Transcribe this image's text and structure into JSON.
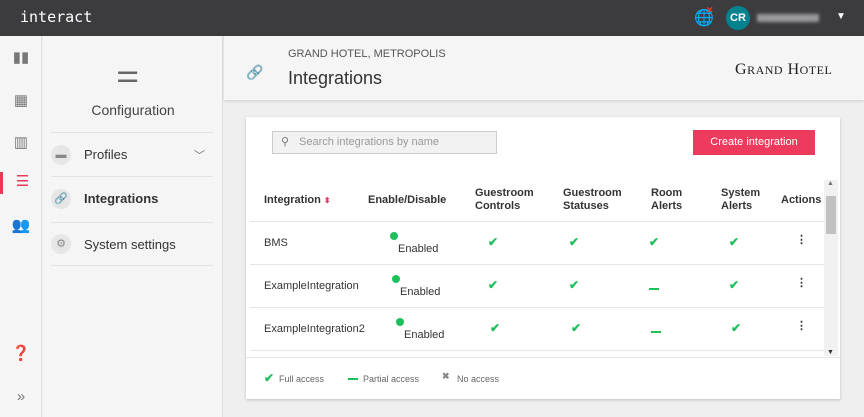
{
  "app": {
    "name": "interact",
    "user_initials": "CR"
  },
  "rail": {
    "items": [
      "dashboard-icon",
      "building-icon",
      "chart-icon",
      "sliders-icon",
      "users-icon",
      "help-icon",
      "expand-icon"
    ]
  },
  "sidebar": {
    "title": "Configuration",
    "items": [
      {
        "label": "Profiles"
      },
      {
        "label": "Integrations"
      },
      {
        "label": "System settings"
      }
    ]
  },
  "header": {
    "breadcrumb": "GRAND HOTEL, METROPOLIS",
    "title": "Integrations",
    "brand": "GRAND HOTEL"
  },
  "toolbar": {
    "search_placeholder": "Search integrations by name",
    "create_label": "Create integration"
  },
  "table": {
    "columns": [
      "Integration",
      "Enable/Disable",
      "Guestroom Controls",
      "Guestroom Statuses",
      "Room Alerts",
      "System Alerts",
      "Actions"
    ],
    "rows": [
      {
        "name": "BMS",
        "status": "Enabled",
        "access": [
          "full",
          "full",
          "full",
          "full"
        ]
      },
      {
        "name": "ExampleIntegration",
        "status": "Enabled",
        "access": [
          "full",
          "full",
          "partial",
          "full"
        ]
      },
      {
        "name": "ExampleIntegration2",
        "status": "Enabled",
        "access": [
          "full",
          "full",
          "partial",
          "full"
        ]
      }
    ]
  },
  "legend": {
    "full": "Full access",
    "partial": "Partial access",
    "none": "No access"
  },
  "colors": {
    "accent": "#ee3b5d",
    "enabled": "#1ec05b",
    "topbar": "#3c3b3e"
  }
}
